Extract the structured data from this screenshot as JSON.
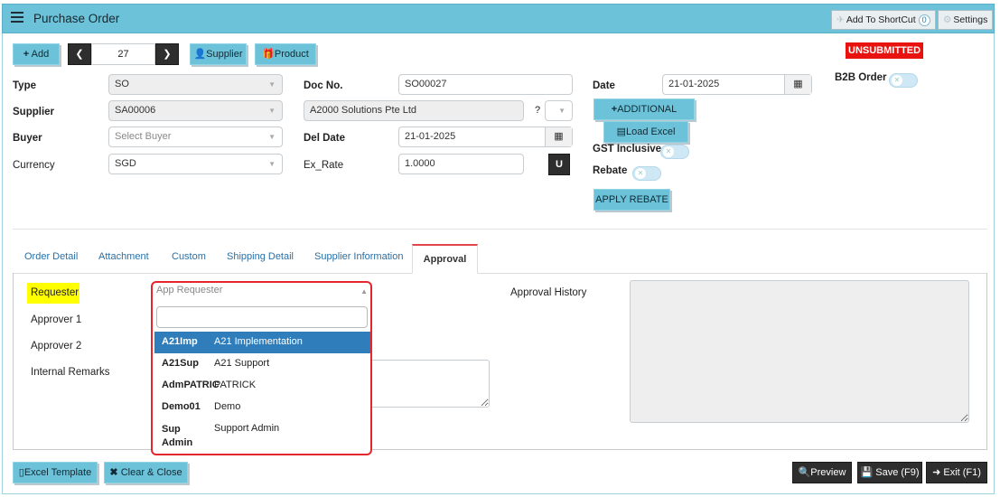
{
  "titlebar": {
    "title": "Purchase Order",
    "add_shortcut_label": "Add To ShortCut",
    "shortcut_count": "0",
    "settings_label": "Settings"
  },
  "toolbar": {
    "add_label": "Add",
    "record_number": "27",
    "supplier_label": "Supplier",
    "product_label": "Product"
  },
  "status_badge": "UNSUBMITTED",
  "form": {
    "type_label": "Type",
    "type_value": "SO",
    "supplier_label": "Supplier",
    "supplier_value": "SA00006",
    "buyer_label": "Buyer",
    "buyer_placeholder": "Select Buyer",
    "currency_label": "Currency",
    "currency_value": "SGD",
    "docno_label": "Doc No.",
    "docno_value": "SO00027",
    "supplier_name_value": "A2000 Solutions Pte Ltd",
    "question_mark": "?",
    "deldate_label": "Del Date",
    "deldate_value": "21-01-2025",
    "exrate_label": "Ex_Rate",
    "exrate_value": "1.0000",
    "u_button": "U",
    "date_label": "Date",
    "date_value": "21-01-2025",
    "additional_label": "ADDITIONAL",
    "load_excel_label": "Load Excel",
    "gst_inclusive_label": "GST Inclusive",
    "rebate_label": "Rebate",
    "apply_rebate_label": "APPLY REBATE",
    "b2b_order_label": "B2B Order"
  },
  "tabs": [
    {
      "label": "Order Detail"
    },
    {
      "label": "Attachment"
    },
    {
      "label": "Custom"
    },
    {
      "label": "Shipping Detail"
    },
    {
      "label": "Supplier Information"
    },
    {
      "label": "Approval"
    }
  ],
  "approval": {
    "requester_label": "Requester",
    "approver1_label": "Approver 1",
    "approver2_label": "Approver 2",
    "internal_remarks_label": "Internal Remarks",
    "approval_history_label": "Approval History",
    "requester_placeholder": "App Requester",
    "options": [
      {
        "code": "A21Imp",
        "name": "A21 Implementation",
        "selected": true
      },
      {
        "code": "A21Sup",
        "name": "A21 Support",
        "selected": false
      },
      {
        "code": "AdmPATRIC",
        "name": "PATRICK",
        "selected": false
      },
      {
        "code": "Demo01",
        "name": "Demo",
        "selected": false
      },
      {
        "code": "Sup Admin",
        "name": "Support Admin",
        "selected": false
      }
    ]
  },
  "footer": {
    "excel_template_label": "Excel Template",
    "clear_close_label": "Clear & Close",
    "preview_label": "Preview",
    "save_label": "Save (F9)",
    "exit_label": "Exit (F1)"
  },
  "colors": {
    "accent": "#6cc3d9",
    "selected": "#2f7dba",
    "status_red": "#e8130f",
    "highlight": "#ffff00"
  }
}
